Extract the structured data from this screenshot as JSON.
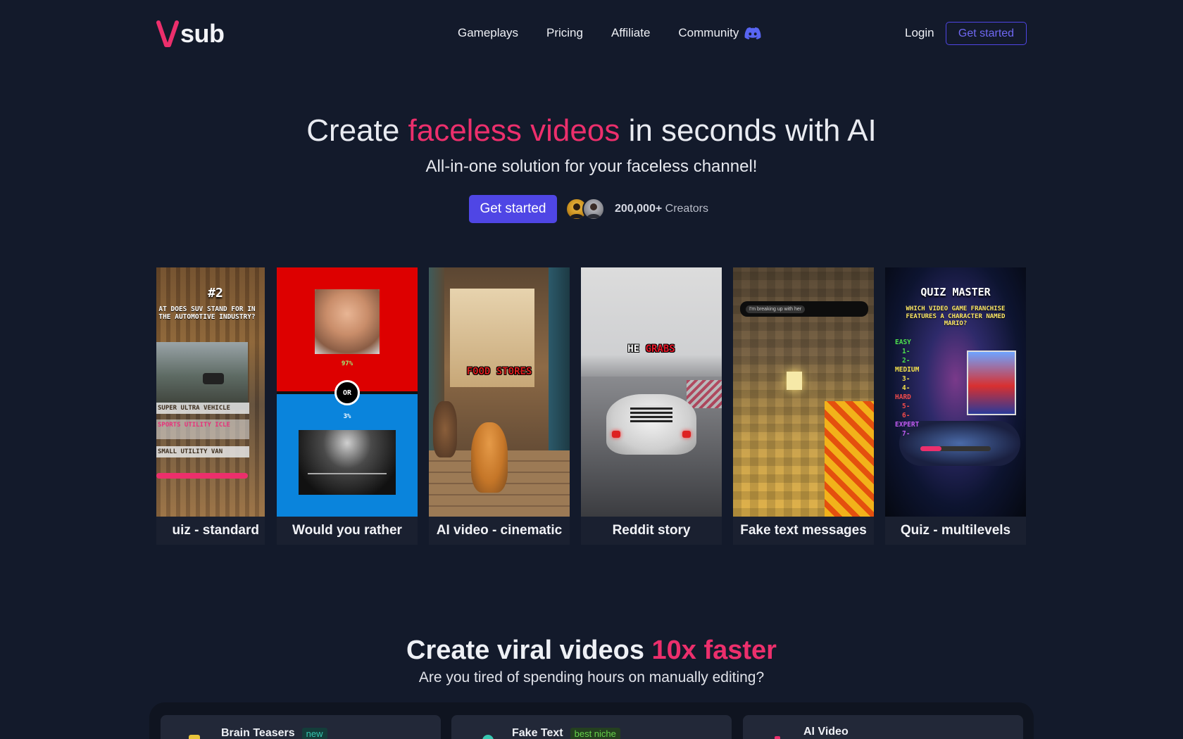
{
  "nav": {
    "logo_text": "sub",
    "links": [
      "Gameplays",
      "Pricing",
      "Affiliate",
      "Community"
    ],
    "login": "Login",
    "cta": "Get started"
  },
  "hero": {
    "title_pre": "Create ",
    "title_accent": "faceless videos",
    "title_post": " in seconds with AI",
    "subtitle": "All-in-one solution for your faceless channel!",
    "cta": "Get started",
    "creators_count": "200,000+",
    "creators_label": "Creators"
  },
  "cards": [
    {
      "label": "uiz - standard",
      "texts": {
        "num": "#2",
        "question": "AT DOES SUV STAND FOR IN THE AUTOMOTIVE INDUSTRY?",
        "opt1": "SUPER ULTRA VEHICLE",
        "opt2": "SPORTS UTILITY ICLE",
        "opt3": "SMALL UTILITY VAN"
      }
    },
    {
      "label": "Would you rather",
      "texts": {
        "pct_top": "97%",
        "or": "OR",
        "pct_bottom": "3%"
      }
    },
    {
      "label": "AI video - cinematic",
      "texts": {
        "caption": "FOOD STORES"
      }
    },
    {
      "label": "Reddit story",
      "texts": {
        "cap1": "HE",
        "cap2": "GRABS"
      }
    },
    {
      "label": "Fake text messages",
      "texts": {
        "message": "I'm breaking up with her"
      }
    },
    {
      "label": "Quiz - multilevels",
      "texts": {
        "title": "QUIZ MASTER",
        "question": "WHICH VIDEO GAME FRANCHISE FEATURES A CHARACTER NAMED MARIO?",
        "l1": "EASY",
        "n1": "1-",
        "n2": "2-",
        "l2": "MEDIUM",
        "n3": "3-",
        "n4": "4-",
        "l3": "HARD",
        "n5": "5-",
        "n6": "6-",
        "l4": "EXPERT",
        "n7": "7-"
      }
    }
  ],
  "section2": {
    "title_pre": "Create viral videos ",
    "title_accent": "10x faster",
    "subtitle": "Are you tired of spending hours on manually editing?"
  },
  "tiles": [
    {
      "title": "Brain Teasers",
      "badge": "new"
    },
    {
      "title": "Fake Text",
      "badge": "best niche"
    },
    {
      "title": "AI Video",
      "badge": ""
    }
  ],
  "colors": {
    "background": "#131a2b",
    "accent_pink": "#ec2f6c",
    "primary": "#4f46e5"
  }
}
